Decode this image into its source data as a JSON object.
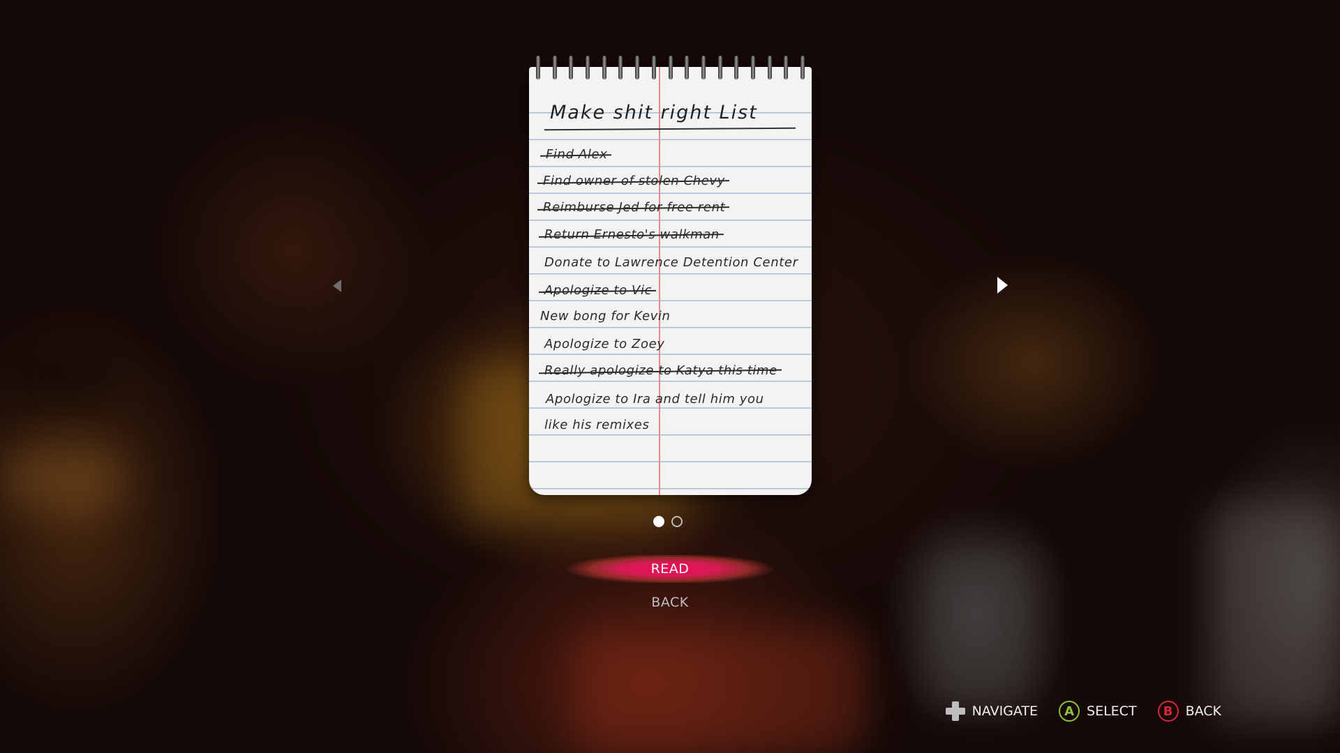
{
  "notebook": {
    "title": "Make shit right List",
    "entries": [
      {
        "text": "Find Alex",
        "crossed_out": true
      },
      {
        "text": "Find owner of stolen Chevy",
        "crossed_out": true
      },
      {
        "text": "Reimburse Jed for free rent",
        "crossed_out": true
      },
      {
        "text": "Return Ernesto's walkman",
        "crossed_out": true
      },
      {
        "text": "Donate to Lawrence Detention Center",
        "crossed_out": false
      },
      {
        "text": "Apologize to Vic",
        "crossed_out": true
      },
      {
        "text": "New bong for Kevin",
        "crossed_out": false
      },
      {
        "text": "Apologize to Zoey",
        "crossed_out": false
      },
      {
        "text": "Really apologize to Katya this time",
        "crossed_out": true
      },
      {
        "text": "Apologize to Ira and tell him you",
        "crossed_out": false
      },
      {
        "text": "like his remixes",
        "crossed_out": false
      }
    ]
  },
  "pagination": {
    "current_page": 1,
    "total_pages": 2
  },
  "menu": {
    "read_label": "READ",
    "back_label": "BACK",
    "selected": "READ",
    "highlight_color": "#e8104f"
  },
  "prompts": {
    "navigate_label": "NAVIGATE",
    "select_label": "SELECT",
    "back_label": "BACK",
    "select_button": "A",
    "back_button": "B",
    "navigate_icon": "dpad-icon",
    "a_color": "#8ec23c",
    "b_color": "#d8243a"
  }
}
